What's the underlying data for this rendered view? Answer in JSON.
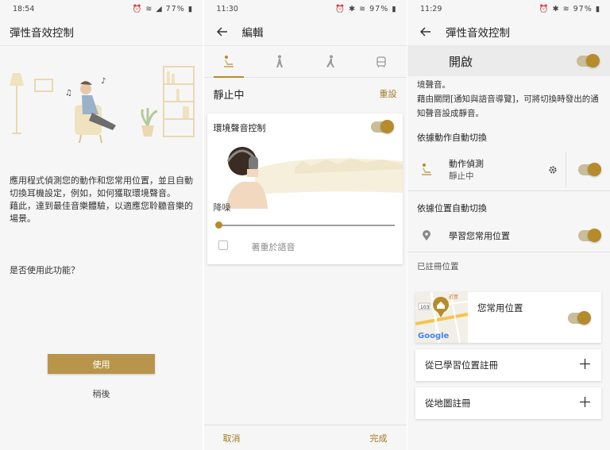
{
  "screen1": {
    "status": {
      "time": "18:54",
      "battery": "77%"
    },
    "title": "彈性音效控制",
    "description": "應用程式偵測您的動作和您常用位置，並且自動切換耳機設定，例如，如何獲取環境聲音。\n藉此，達到最佳音樂體驗，以適應您聆聽音樂的場景。",
    "question": "是否使用此功能？",
    "use_button": "使用",
    "later_button": "稍後"
  },
  "screen2": {
    "status": {
      "time": "11:30",
      "battery": "97%"
    },
    "title": "編輯",
    "tabs": [
      "stationary-icon",
      "walking-icon",
      "running-icon",
      "transport-icon"
    ],
    "state_label": "靜止中",
    "reset": "重設",
    "card": {
      "title": "環境聲音控制",
      "noise_cancel": "降噪",
      "slider_value": 0,
      "checkbox_label": "著重於語音"
    },
    "cancel": "取消",
    "done": "完成"
  },
  "screen3": {
    "status": {
      "time": "11:29",
      "battery": "97%"
    },
    "title": "彈性音效控制",
    "on_label": "開啟",
    "description": "境聲音。\n藉由關閉[通知與語音導覽]，可將切換時發出的通知聲音設成靜音。",
    "section_action": "依據動作自動切換",
    "action_title": "動作偵測",
    "action_sub": "靜止中",
    "section_location": "依據位置自動切換",
    "location_learn": "學習您常用位置",
    "section_registered": "已註冊位置",
    "frequent_place": "您常用位置",
    "map_road_number": "103",
    "map_text": "近音",
    "map_brand": "Google",
    "register_learned": "從已學習位置註冊",
    "register_map": "從地圖註冊"
  },
  "colors": {
    "accent": "#b58b2b",
    "button": "#b8954a",
    "bg": "#f6f6f6"
  }
}
